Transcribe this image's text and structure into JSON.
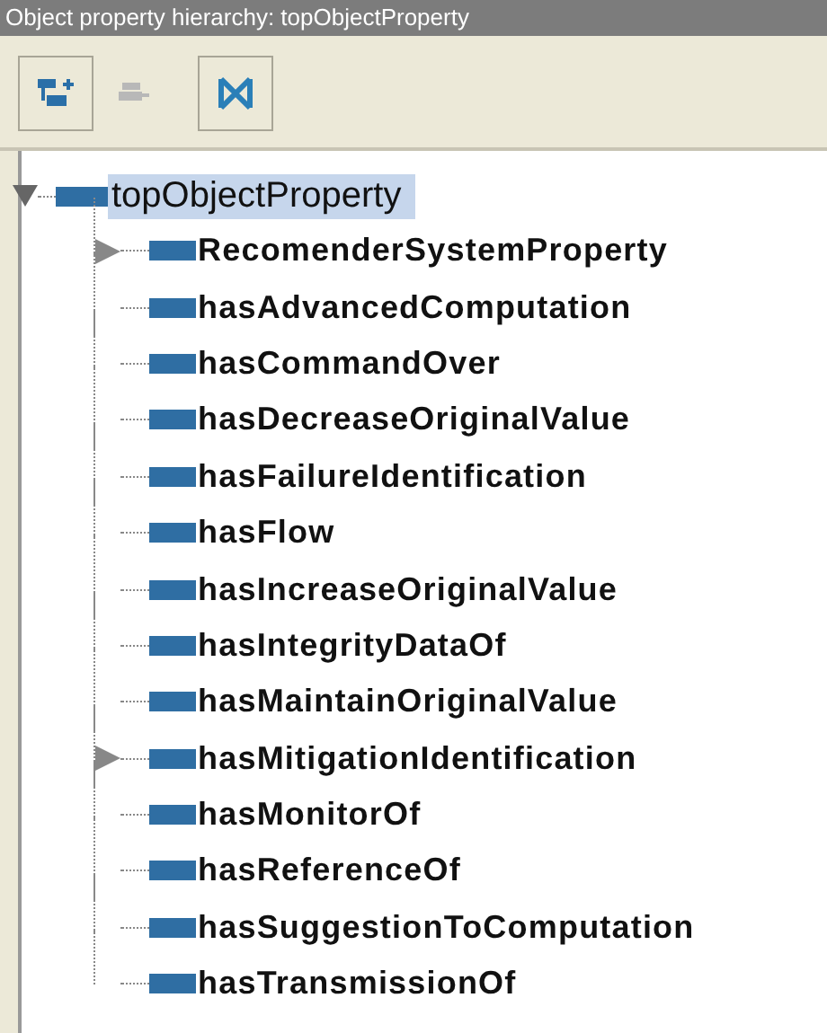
{
  "panel": {
    "title": "Object property hierarchy: topObjectProperty"
  },
  "toolbar": [
    {
      "kind": "add-sub",
      "disabled": false
    },
    {
      "kind": "delete",
      "disabled": true
    },
    {
      "kind": "collapse",
      "disabled": false
    }
  ],
  "tree": {
    "label": "topObjectProperty",
    "selected": true,
    "expanded": true,
    "children": [
      {
        "label": "RecomenderSystemProperty",
        "selected": false,
        "expandable": true
      },
      {
        "label": "hasAdvancedComputation",
        "selected": false,
        "expandable": false
      },
      {
        "label": "hasCommandOver",
        "selected": false,
        "expandable": false
      },
      {
        "label": "hasDecreaseOriginalValue",
        "selected": false,
        "expandable": false
      },
      {
        "label": "hasFailureIdentification",
        "selected": false,
        "expandable": false
      },
      {
        "label": "hasFlow",
        "selected": false,
        "expandable": false
      },
      {
        "label": "hasIncreaseOriginalValue",
        "selected": false,
        "expandable": false
      },
      {
        "label": "hasIntegrityDataOf",
        "selected": false,
        "expandable": false
      },
      {
        "label": "hasMaintainOriginalValue",
        "selected": false,
        "expandable": false
      },
      {
        "label": "hasMitigationIdentification",
        "selected": false,
        "expandable": true
      },
      {
        "label": "hasMonitorOf",
        "selected": false,
        "expandable": false
      },
      {
        "label": "hasReferenceOf",
        "selected": false,
        "expandable": false
      },
      {
        "label": "hasSuggestionToComputation",
        "selected": false,
        "expandable": false
      },
      {
        "label": "hasTransmissionOf",
        "selected": false,
        "expandable": false
      }
    ]
  }
}
